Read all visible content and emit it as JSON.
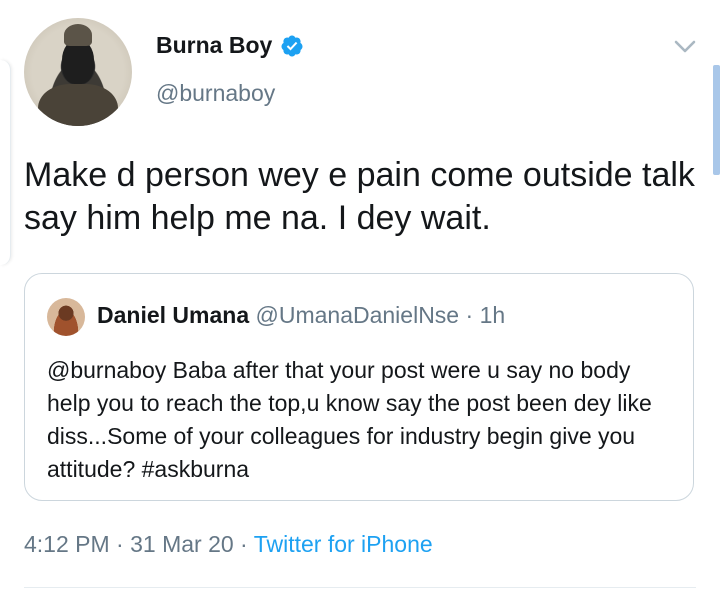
{
  "tweet": {
    "author_name": "Burna Boy",
    "author_handle": "@burnaboy",
    "text": "Make d person wey e pain come outside talk say him help me na. I dey wait.",
    "timestamp_time": "4:12 PM",
    "timestamp_date": "31 Mar 20",
    "source": "Twitter for iPhone",
    "separator": " · "
  },
  "quoted_tweet": {
    "author_name": "Daniel Umana",
    "author_handle": "@UmanaDanielNse",
    "time_ago": "1h",
    "separator": " · ",
    "text": "@burnaboy Baba after that your post were u say no body help you to reach the top,u know say the post been dey like diss...Some of your colleagues for industry begin give you attitude? #askburna"
  },
  "icons": {
    "verified": "verified-badge-icon",
    "menu": "chevron-down-icon"
  },
  "colors": {
    "accent": "#1da1f2",
    "text_primary": "#14171a",
    "text_secondary": "#657786",
    "border": "#ccd6dd"
  }
}
